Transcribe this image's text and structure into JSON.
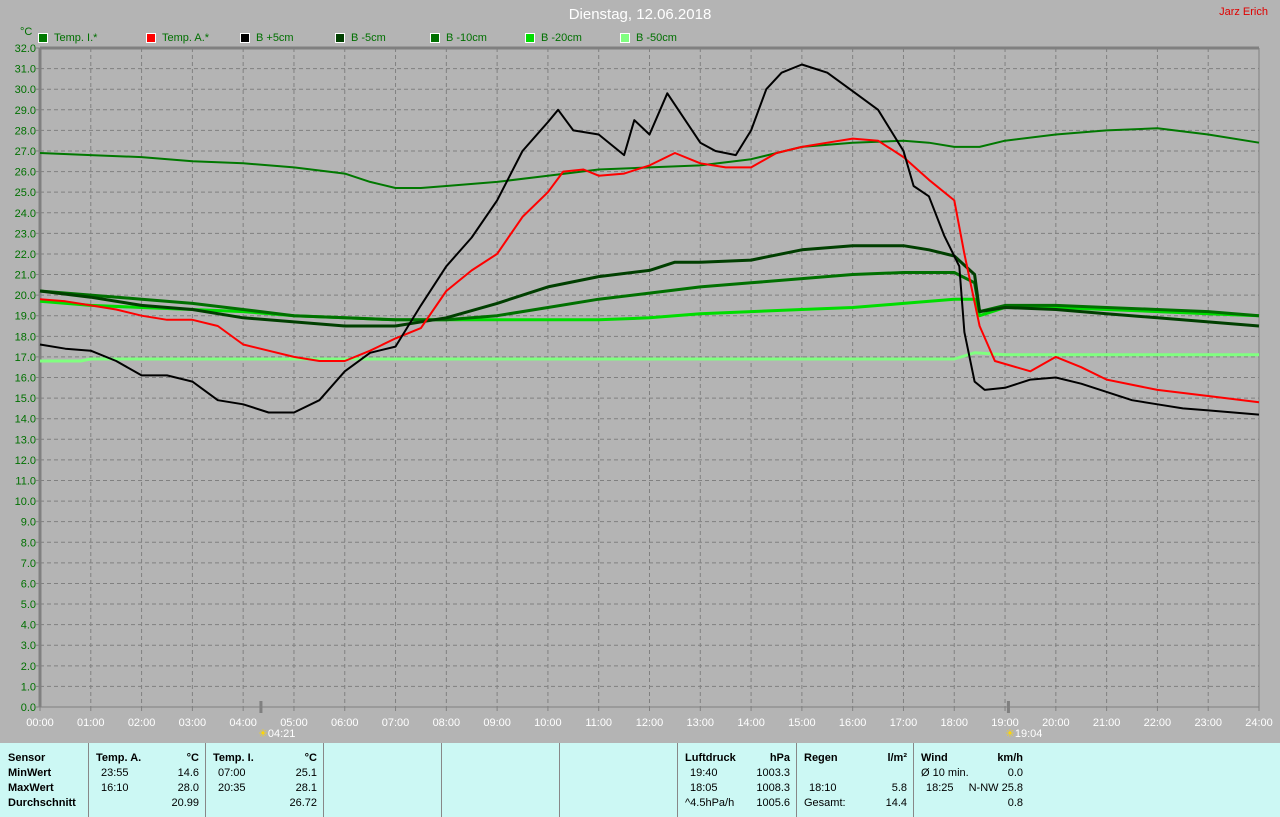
{
  "header": {
    "title": "Dienstag, 12.06.2018",
    "owner": "Jarz Erich",
    "unit": "°C"
  },
  "markers": {
    "sunrise": "04:21",
    "sunset": "19:04",
    "sunrise_hour": 4.35,
    "sunset_hour": 19.067
  },
  "chart_data": {
    "type": "line",
    "title": "Dienstag, 12.06.2018",
    "xlabel": "",
    "ylabel": "°C",
    "xlim": [
      0,
      24
    ],
    "ylim": [
      0,
      32
    ],
    "grid": true,
    "legend_position": "top",
    "x_ticks": [
      "00:00",
      "01:00",
      "02:00",
      "03:00",
      "04:00",
      "05:00",
      "06:00",
      "07:00",
      "08:00",
      "09:00",
      "10:00",
      "11:00",
      "12:00",
      "13:00",
      "14:00",
      "15:00",
      "16:00",
      "17:00",
      "18:00",
      "19:00",
      "20:00",
      "21:00",
      "22:00",
      "23:00",
      "24:00"
    ],
    "y_ticks": [
      "0.0",
      "1.0",
      "2.0",
      "3.0",
      "4.0",
      "5.0",
      "6.0",
      "7.0",
      "8.0",
      "9.0",
      "10.0",
      "11.0",
      "12.0",
      "13.0",
      "14.0",
      "15.0",
      "16.0",
      "17.0",
      "18.0",
      "19.0",
      "20.0",
      "21.0",
      "22.0",
      "23.0",
      "24.0",
      "25.0",
      "26.0",
      "27.0",
      "28.0",
      "29.0",
      "30.0",
      "31.0",
      "32.0"
    ],
    "series": [
      {
        "name": "Temp. I.*",
        "color": "#007800",
        "width": 2,
        "points": [
          [
            0,
            26.9
          ],
          [
            1,
            26.8
          ],
          [
            2,
            26.7
          ],
          [
            3,
            26.5
          ],
          [
            4,
            26.4
          ],
          [
            5,
            26.2
          ],
          [
            6,
            25.9
          ],
          [
            6.5,
            25.5
          ],
          [
            7,
            25.2
          ],
          [
            7.5,
            25.2
          ],
          [
            8,
            25.3
          ],
          [
            9,
            25.5
          ],
          [
            10,
            25.8
          ],
          [
            11,
            26.1
          ],
          [
            12,
            26.2
          ],
          [
            13,
            26.3
          ],
          [
            14,
            26.6
          ],
          [
            15,
            27.2
          ],
          [
            16,
            27.4
          ],
          [
            17,
            27.5
          ],
          [
            17.5,
            27.4
          ],
          [
            18,
            27.2
          ],
          [
            18.5,
            27.2
          ],
          [
            19,
            27.5
          ],
          [
            20,
            27.8
          ],
          [
            21,
            28.0
          ],
          [
            22,
            28.1
          ],
          [
            23,
            27.8
          ],
          [
            24,
            27.4
          ]
        ]
      },
      {
        "name": "Temp. A.*",
        "color": "#ff0000",
        "width": 2,
        "points": [
          [
            0,
            19.8
          ],
          [
            0.5,
            19.7
          ],
          [
            1,
            19.5
          ],
          [
            1.5,
            19.3
          ],
          [
            2,
            19.0
          ],
          [
            2.5,
            18.8
          ],
          [
            3,
            18.8
          ],
          [
            3.5,
            18.5
          ],
          [
            4,
            17.6
          ],
          [
            4.5,
            17.3
          ],
          [
            5,
            17.0
          ],
          [
            5.5,
            16.8
          ],
          [
            6,
            16.8
          ],
          [
            6.5,
            17.3
          ],
          [
            7,
            17.9
          ],
          [
            7.5,
            18.4
          ],
          [
            8,
            20.2
          ],
          [
            8.5,
            21.2
          ],
          [
            9,
            22.0
          ],
          [
            9.5,
            23.8
          ],
          [
            10,
            25.0
          ],
          [
            10.3,
            26.0
          ],
          [
            10.7,
            26.1
          ],
          [
            11,
            25.8
          ],
          [
            11.5,
            25.9
          ],
          [
            12,
            26.3
          ],
          [
            12.5,
            26.9
          ],
          [
            13,
            26.4
          ],
          [
            13.5,
            26.2
          ],
          [
            14,
            26.2
          ],
          [
            14.5,
            26.9
          ],
          [
            15,
            27.2
          ],
          [
            15.5,
            27.4
          ],
          [
            16,
            27.6
          ],
          [
            16.5,
            27.5
          ],
          [
            17,
            26.7
          ],
          [
            17.5,
            25.6
          ],
          [
            18,
            24.6
          ],
          [
            18.2,
            22.0
          ],
          [
            18.5,
            18.5
          ],
          [
            18.8,
            16.8
          ],
          [
            19.5,
            16.3
          ],
          [
            20,
            17.0
          ],
          [
            20.5,
            16.5
          ],
          [
            21,
            15.9
          ],
          [
            22,
            15.4
          ],
          [
            23,
            15.1
          ],
          [
            24,
            14.8
          ]
        ]
      },
      {
        "name": "B +5cm",
        "color": "#000000",
        "width": 2,
        "points": [
          [
            0,
            17.6
          ],
          [
            0.5,
            17.4
          ],
          [
            1,
            17.3
          ],
          [
            1.5,
            16.8
          ],
          [
            2,
            16.1
          ],
          [
            2.5,
            16.1
          ],
          [
            3,
            15.8
          ],
          [
            3.5,
            14.9
          ],
          [
            4,
            14.7
          ],
          [
            4.5,
            14.3
          ],
          [
            5,
            14.3
          ],
          [
            5.5,
            14.9
          ],
          [
            6,
            16.3
          ],
          [
            6.5,
            17.2
          ],
          [
            7,
            17.5
          ],
          [
            7.5,
            19.5
          ],
          [
            8,
            21.4
          ],
          [
            8.5,
            22.8
          ],
          [
            9,
            24.6
          ],
          [
            9.5,
            27.0
          ],
          [
            10,
            28.4
          ],
          [
            10.2,
            29.0
          ],
          [
            10.5,
            28.0
          ],
          [
            11,
            27.8
          ],
          [
            11.5,
            26.8
          ],
          [
            11.7,
            28.5
          ],
          [
            12,
            27.8
          ],
          [
            12.35,
            29.8
          ],
          [
            13,
            27.4
          ],
          [
            13.3,
            27.0
          ],
          [
            13.7,
            26.8
          ],
          [
            14,
            28.0
          ],
          [
            14.3,
            30.0
          ],
          [
            14.6,
            30.8
          ],
          [
            15,
            31.2
          ],
          [
            15.5,
            30.8
          ],
          [
            16,
            29.9
          ],
          [
            16.5,
            29.0
          ],
          [
            17,
            27.0
          ],
          [
            17.2,
            25.3
          ],
          [
            17.5,
            24.8
          ],
          [
            17.8,
            22.9
          ],
          [
            18.1,
            21.4
          ],
          [
            18.2,
            18.2
          ],
          [
            18.4,
            15.8
          ],
          [
            18.6,
            15.4
          ],
          [
            19,
            15.5
          ],
          [
            19.5,
            15.9
          ],
          [
            20,
            16.0
          ],
          [
            20.5,
            15.7
          ],
          [
            21,
            15.3
          ],
          [
            21.5,
            14.9
          ],
          [
            22,
            14.7
          ],
          [
            22.5,
            14.5
          ],
          [
            23,
            14.4
          ],
          [
            24,
            14.2
          ]
        ]
      },
      {
        "name": "B -5cm",
        "color": "#003f00",
        "width": 3,
        "points": [
          [
            0,
            20.2
          ],
          [
            1,
            19.9
          ],
          [
            2,
            19.5
          ],
          [
            3,
            19.3
          ],
          [
            4,
            18.9
          ],
          [
            5,
            18.7
          ],
          [
            6,
            18.5
          ],
          [
            7,
            18.5
          ],
          [
            8,
            18.9
          ],
          [
            9,
            19.6
          ],
          [
            10,
            20.4
          ],
          [
            11,
            20.9
          ],
          [
            12,
            21.2
          ],
          [
            12.5,
            21.6
          ],
          [
            13,
            21.6
          ],
          [
            14,
            21.7
          ],
          [
            15,
            22.2
          ],
          [
            16,
            22.4
          ],
          [
            17,
            22.4
          ],
          [
            17.5,
            22.2
          ],
          [
            18,
            21.9
          ],
          [
            18.4,
            21.0
          ],
          [
            18.5,
            19.2
          ],
          [
            19,
            19.4
          ],
          [
            20,
            19.3
          ],
          [
            21,
            19.1
          ],
          [
            22,
            18.9
          ],
          [
            23,
            18.7
          ],
          [
            24,
            18.5
          ]
        ]
      },
      {
        "name": "B -10cm",
        "color": "#007000",
        "width": 3,
        "points": [
          [
            0,
            20.2
          ],
          [
            1,
            20.0
          ],
          [
            2,
            19.8
          ],
          [
            3,
            19.6
          ],
          [
            4,
            19.3
          ],
          [
            5,
            19.0
          ],
          [
            6,
            18.9
          ],
          [
            7,
            18.8
          ],
          [
            8,
            18.8
          ],
          [
            9,
            19.0
          ],
          [
            10,
            19.4
          ],
          [
            11,
            19.8
          ],
          [
            12,
            20.1
          ],
          [
            13,
            20.4
          ],
          [
            14,
            20.6
          ],
          [
            15,
            20.8
          ],
          [
            16,
            21.0
          ],
          [
            17,
            21.1
          ],
          [
            18,
            21.1
          ],
          [
            18.4,
            20.6
          ],
          [
            18.5,
            19.2
          ],
          [
            19,
            19.5
          ],
          [
            20,
            19.5
          ],
          [
            21,
            19.4
          ],
          [
            22,
            19.3
          ],
          [
            23,
            19.2
          ],
          [
            24,
            19.0
          ]
        ]
      },
      {
        "name": "B -20cm",
        "color": "#00dd00",
        "width": 3,
        "points": [
          [
            0,
            19.7
          ],
          [
            1,
            19.5
          ],
          [
            2,
            19.4
          ],
          [
            3,
            19.3
          ],
          [
            4,
            19.2
          ],
          [
            5,
            19.0
          ],
          [
            6,
            18.9
          ],
          [
            7,
            18.8
          ],
          [
            8,
            18.8
          ],
          [
            9,
            18.8
          ],
          [
            10,
            18.8
          ],
          [
            11,
            18.8
          ],
          [
            12,
            18.9
          ],
          [
            13,
            19.1
          ],
          [
            14,
            19.2
          ],
          [
            15,
            19.3
          ],
          [
            16,
            19.4
          ],
          [
            17,
            19.6
          ],
          [
            18,
            19.8
          ],
          [
            18.4,
            19.8
          ],
          [
            18.5,
            19.0
          ],
          [
            19,
            19.4
          ],
          [
            20,
            19.4
          ],
          [
            21,
            19.3
          ],
          [
            22,
            19.2
          ],
          [
            23,
            19.1
          ],
          [
            24,
            19.0
          ]
        ]
      },
      {
        "name": "B -50cm",
        "color": "#80ff80",
        "width": 3,
        "points": [
          [
            0,
            16.8
          ],
          [
            0.8,
            16.8
          ],
          [
            1,
            16.9
          ],
          [
            18,
            16.9
          ],
          [
            18.4,
            17.2
          ],
          [
            19,
            17.1
          ],
          [
            24,
            17.1
          ]
        ]
      }
    ]
  },
  "stats": {
    "sensor": {
      "h": "Sensor",
      "min": "MinWert",
      "max": "MaxWert",
      "avg": "Durchschnitt"
    },
    "temp_a": {
      "h": "Temp. A.",
      "u": "°C",
      "min_t": "23:55",
      "min": "14.6",
      "max_t": "16:10",
      "max": "28.0",
      "avg": "20.99"
    },
    "temp_i": {
      "h": "Temp. I.",
      "u": "°C",
      "min_t": "07:00",
      "min": "25.1",
      "max_t": "20:35",
      "max": "28.1",
      "avg": "26.72"
    },
    "pressure": {
      "h": "Luftdruck",
      "u": "hPa",
      "min_t": "19:40",
      "min": "1003.3",
      "max_t": "18:05",
      "max": "1008.3",
      "trend": "^4.5hPa/h",
      "avg": "1005.6"
    },
    "rain": {
      "h": "Regen",
      "u": "l/m²",
      "max_t": "18:10",
      "max": "5.8",
      "total_l": "Gesamt:",
      "total": "14.4"
    },
    "wind": {
      "h": "Wind",
      "u": "km/h",
      "avg10_l": "Ø 10 min.",
      "avg10": "0.0",
      "max_t": "18:25",
      "max": "N-NW 25.8",
      "avg": "0.8"
    }
  }
}
